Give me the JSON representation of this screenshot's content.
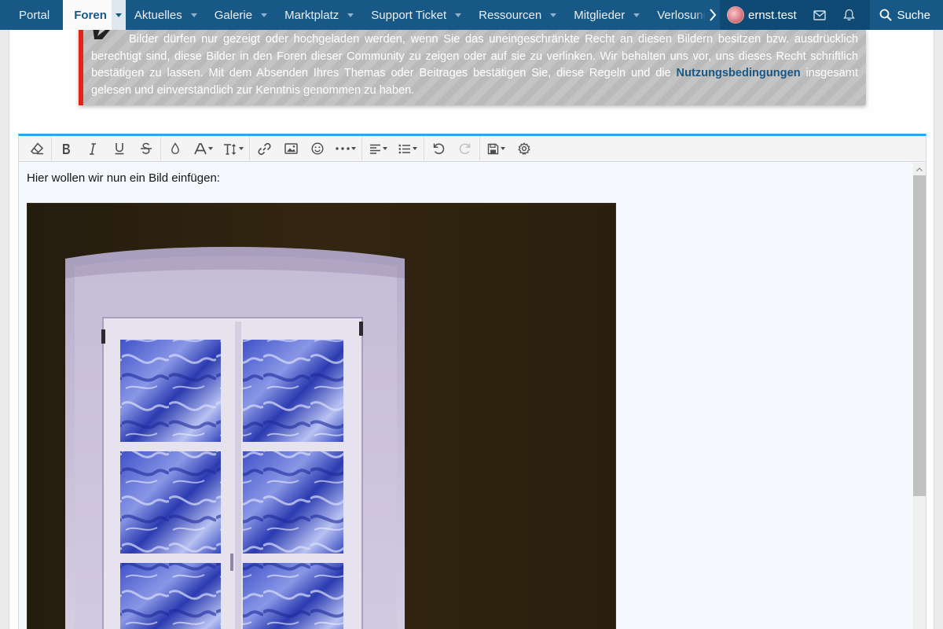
{
  "nav": {
    "tabs": [
      {
        "label": "Portal",
        "has_caret": false
      },
      {
        "label": "Foren",
        "has_caret": true,
        "active": true
      },
      {
        "label": "Aktuelles",
        "has_caret": true
      },
      {
        "label": "Galerie",
        "has_caret": true
      },
      {
        "label": "Marktplatz",
        "has_caret": true
      },
      {
        "label": "Support Ticket",
        "has_caret": true
      },
      {
        "label": "Ressourcen",
        "has_caret": true
      },
      {
        "label": "Mitglieder",
        "has_caret": true
      },
      {
        "label": "Verlosungen",
        "has_caret": false
      }
    ],
    "more_icon": "chevron-right-icon",
    "user_name": "ernst.test",
    "inbox_icon": "envelope-icon",
    "alerts_icon": "bell-icon",
    "search_label": "Suche"
  },
  "notice": {
    "text_before_link": "Bilder dürfen nur gezeigt oder hochgeladen werden, wenn Sie das uneingeschränkte Recht an diesen Bildern besitzen bzw. ausdrücklich berechtigt sind, diese Bilder in den Foren dieser Community zu zeigen oder auf sie zu verlinken. Wir behalten uns vor, uns dieses Recht schriftlich bestätigen zu lassen. Mit dem Absenden Ihres Themas oder Beitrages bestätigen Sie, diese Regeln und die ",
    "link": "Nutzungsbedingungen",
    "text_after_link": " insgesamt gelesen und einverständlich zur Kenntnis genommen zu haben.",
    "accent_color": "#e2231a"
  },
  "editor": {
    "toolbar": [
      "eraser-icon",
      "bold-icon",
      "italic-icon",
      "underline-icon",
      "strikethrough-icon",
      "text-color-icon",
      "font-family-icon",
      "font-size-icon",
      "link-icon",
      "image-icon",
      "smiley-icon",
      "more-options-icon",
      "align-icon",
      "list-icon",
      "undo-icon",
      "redo-icon",
      "drafts-icon",
      "settings-icon"
    ],
    "text": "Hier wollen wir nun ein Bild einfügen:",
    "accent_color": "#2ba6ea"
  },
  "colors": {
    "nav_bg": "#185886",
    "nav_user_bg": "#0f4a74",
    "link": "#185886"
  }
}
